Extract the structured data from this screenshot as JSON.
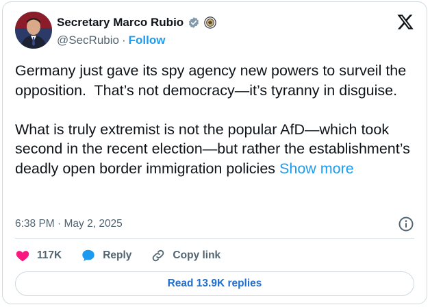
{
  "author": {
    "name": "Secretary Marco Rubio",
    "handle": "@SecRubio",
    "separator": "·",
    "follow_label": "Follow"
  },
  "tweet": {
    "text": "Germany just gave its spy agency new powers to surveil the opposition.  That’s not democracy—it’s tyranny in disguise.\n\nWhat is truly extremist is not the popular AfD—which took second in the recent election—but rather the establishment’s deadly open border immigration policies ",
    "show_more_label": "Show more",
    "timestamp": "6:38 PM · May 2, 2025"
  },
  "actions": {
    "like_count": "117K",
    "reply_label": "Reply",
    "copy_link_label": "Copy link"
  },
  "replies_button_label": "Read 13.9K replies",
  "icons": {
    "verified": "verified-badge-icon",
    "seal": "government-seal-icon",
    "platform": "x-logo-icon",
    "info": "info-icon",
    "like": "heart-icon",
    "reply": "reply-bubble-icon",
    "copy": "link-icon"
  },
  "colors": {
    "accent": "#1d9bf0",
    "like": "#f91880",
    "muted": "#536471",
    "text": "#0f1419",
    "border": "#cfd9de"
  }
}
